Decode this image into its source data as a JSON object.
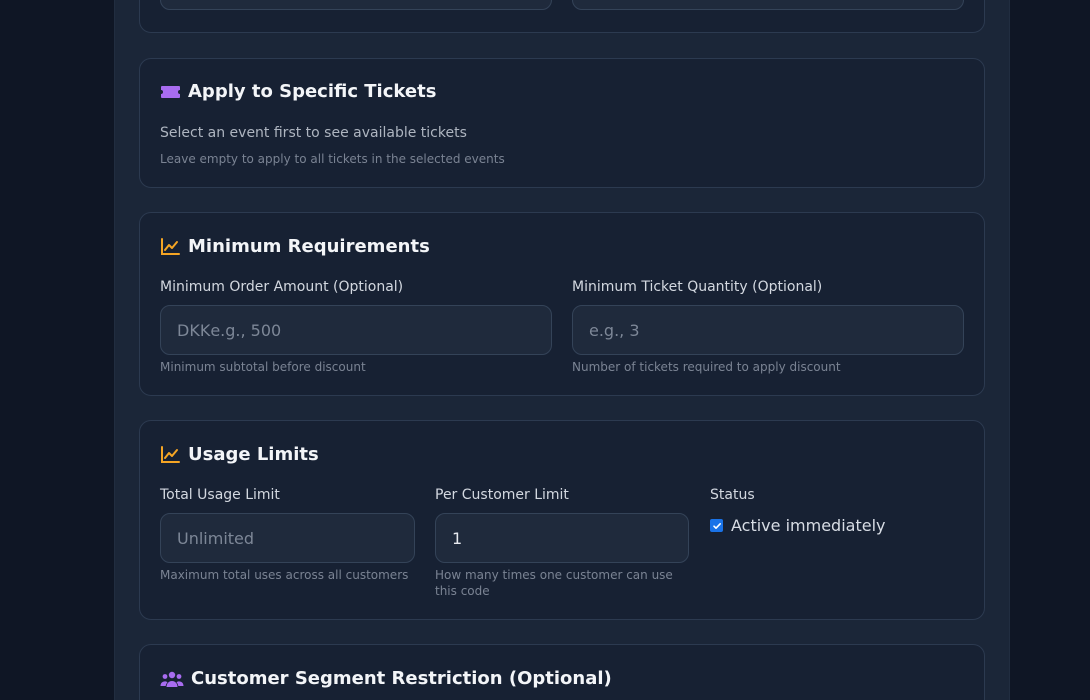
{
  "tickets": {
    "title": "Apply to Specific Tickets",
    "message": "Select an event first to see available tickets",
    "help": "Leave empty to apply to all tickets in the selected events",
    "icon": "ticket-icon"
  },
  "requirements": {
    "title": "Minimum Requirements",
    "icon": "chart-line-icon",
    "min_order": {
      "label": "Minimum Order Amount (Optional)",
      "prefix": "DKK",
      "placeholder": "e.g., 500",
      "help": "Minimum subtotal before discount"
    },
    "min_qty": {
      "label": "Minimum Ticket Quantity (Optional)",
      "placeholder": "e.g., 3",
      "help": "Number of tickets required to apply discount"
    }
  },
  "usage": {
    "title": "Usage Limits",
    "icon": "chart-line-icon",
    "total": {
      "label": "Total Usage Limit",
      "placeholder": "Unlimited",
      "help": "Maximum total uses across all customers"
    },
    "per_customer": {
      "label": "Per Customer Limit",
      "value": "1",
      "help": "How many times one customer can use this code"
    },
    "status": {
      "label": "Status",
      "checkbox_label": "Active immediately",
      "checked": true
    }
  },
  "segment": {
    "title": "Customer Segment Restriction (Optional)",
    "icon": "users-icon"
  },
  "colors": {
    "accent_purple": "#a86cf0",
    "accent_orange": "#f5a524",
    "checkbox_blue": "#1a73e8"
  }
}
